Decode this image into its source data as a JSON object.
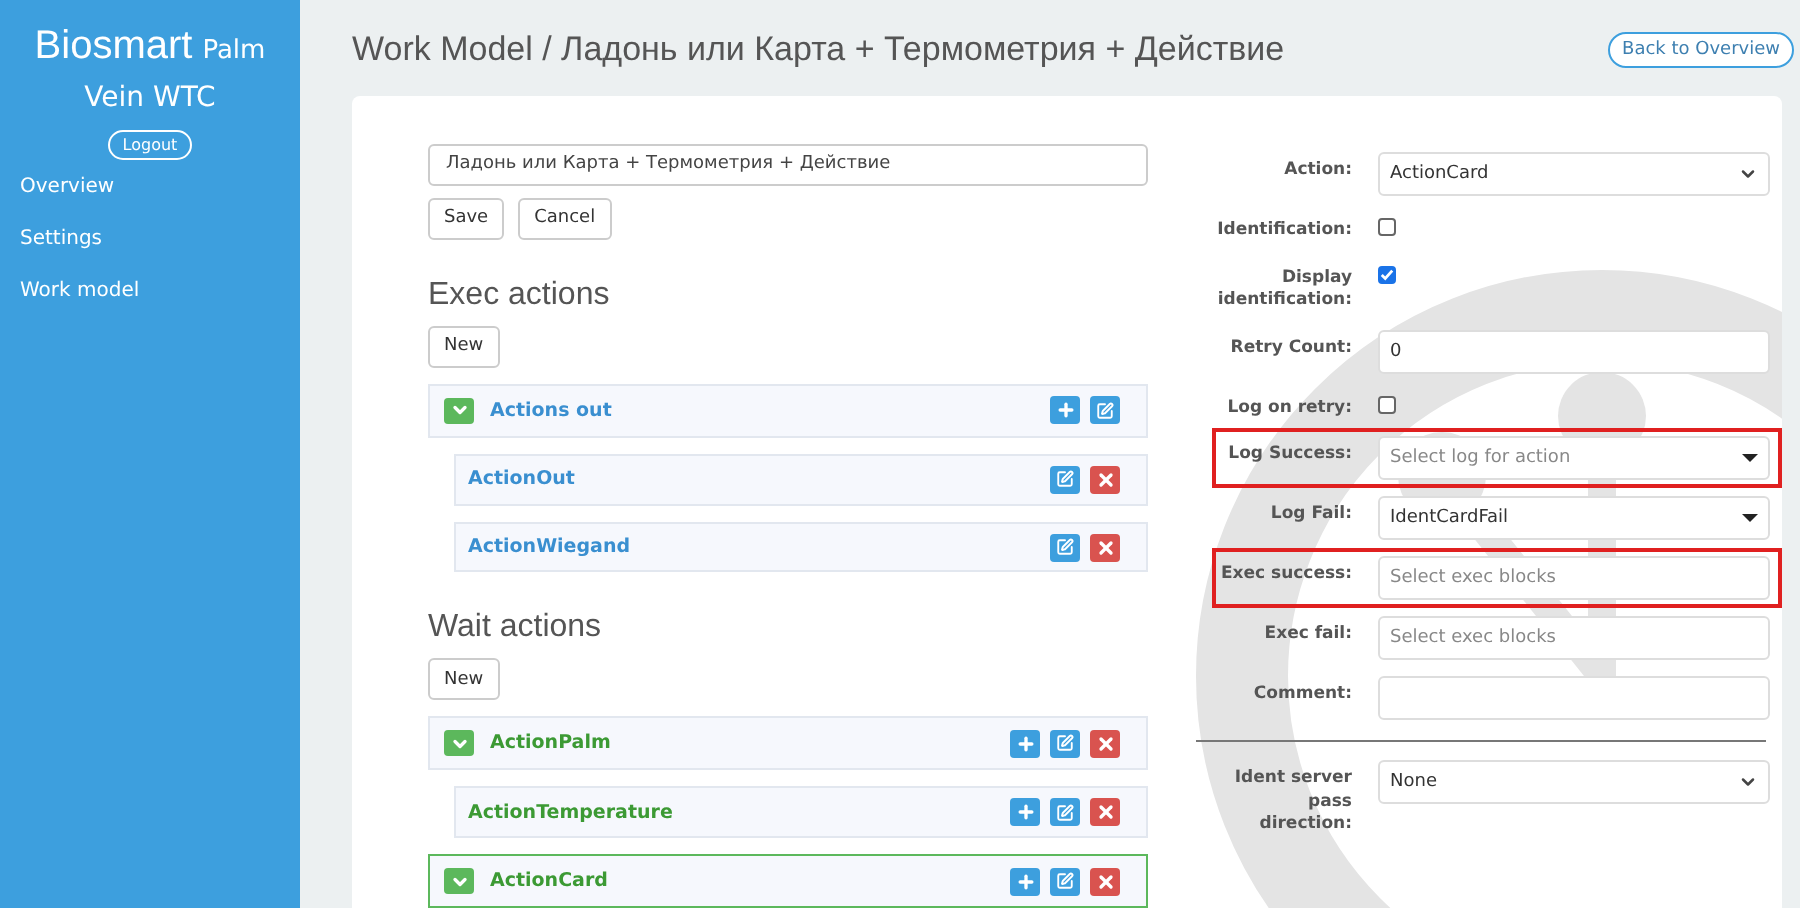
{
  "sidebar": {
    "brand": "Biosmart",
    "brand_suffix": "Palm",
    "subtitle": "Vein WTC",
    "logout": "Logout",
    "items": [
      {
        "label": "Overview",
        "selected": false
      },
      {
        "label": "Settings",
        "selected": false
      },
      {
        "label": "Work model",
        "selected": false
      }
    ]
  },
  "header": {
    "title": "Work Model / Ладонь или Карта + Термометрия + Действие",
    "back": "Back to Overview"
  },
  "editor": {
    "name_value": "Ладонь или Карта + Термометрия + Действие",
    "save": "Save",
    "cancel": "Cancel"
  },
  "sections": [
    {
      "title": "Exec actions",
      "new": "New",
      "items": [
        {
          "label": "Actions out",
          "color": "#3a8fd0",
          "selected": false,
          "expanded": true,
          "buttons": [
            {
              "kind": "add"
            },
            {
              "kind": "edit"
            }
          ],
          "children": [
            {
              "label": "ActionOut",
              "color": "#3a8fd0",
              "selected": false,
              "buttons": [
                {
                  "kind": "edit"
                },
                {
                  "kind": "delete"
                }
              ]
            },
            {
              "label": "ActionWiegand",
              "color": "#3a8fd0",
              "selected": false,
              "buttons": [
                {
                  "kind": "edit"
                },
                {
                  "kind": "delete"
                }
              ]
            }
          ]
        }
      ]
    },
    {
      "title": "Wait actions",
      "new": "New",
      "items": [
        {
          "label": "ActionPalm",
          "color": "#3c9a34",
          "selected": false,
          "expanded": true,
          "buttons": [
            {
              "kind": "add"
            },
            {
              "kind": "edit"
            },
            {
              "kind": "delete"
            }
          ],
          "children": [
            {
              "label": "ActionTemperature",
              "color": "#3c9a34",
              "selected": false,
              "buttons": [
                {
                  "kind": "add"
                },
                {
                  "kind": "edit"
                },
                {
                  "kind": "delete"
                }
              ]
            }
          ]
        },
        {
          "label": "ActionCard",
          "color": "#3c9a34",
          "selected": true,
          "expanded": true,
          "buttons": [
            {
              "kind": "add"
            },
            {
              "kind": "edit"
            },
            {
              "kind": "delete"
            }
          ]
        }
      ]
    }
  ],
  "form": [
    {
      "label": "Action:",
      "kind": "select",
      "value": "ActionCard",
      "highlighted": false
    },
    {
      "label": "Identification:",
      "kind": "checkbox",
      "checked": false,
      "highlighted": false
    },
    {
      "label": "Display identification:",
      "kind": "checkbox",
      "checked": true,
      "highlighted": false
    },
    {
      "label": "Retry Count:",
      "kind": "text",
      "value": "0",
      "highlighted": false
    },
    {
      "label": "Log on retry:",
      "kind": "checkbox",
      "checked": false,
      "highlighted": false
    },
    {
      "label": "Log Success:",
      "kind": "dropdown",
      "placeholder": "Select log for action",
      "highlighted": true
    },
    {
      "label": "Log Fail:",
      "kind": "dropdown",
      "value": "IdentCardFail",
      "highlighted": false
    },
    {
      "label": "Exec success:",
      "kind": "text",
      "placeholder": "Select exec blocks",
      "highlighted": true
    },
    {
      "label": "Exec fail:",
      "kind": "text",
      "placeholder": "Select exec blocks",
      "highlighted": false
    },
    {
      "label": "Comment:",
      "kind": "text",
      "highlighted": false
    },
    {
      "kind": "divider"
    },
    {
      "label": "Ident server pass direction:",
      "kind": "select",
      "value": "None",
      "highlighted": false
    }
  ]
}
